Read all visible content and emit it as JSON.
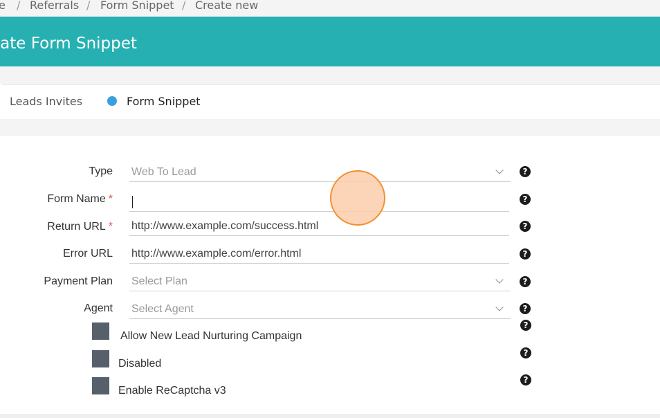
{
  "breadcrumb": {
    "items": [
      "e",
      "Referrals",
      "Form Snippet",
      "Create new"
    ],
    "separator": "/"
  },
  "header": {
    "title": "eate Form Snippet",
    "color": "#26b0b2"
  },
  "tabs": {
    "inactive_label": "Leads Invites",
    "active_label": "Form Snippet",
    "active_dot_color": "#3a9fe0"
  },
  "form": {
    "type": {
      "label": "Type",
      "value": "Web To Lead"
    },
    "form_name": {
      "label": "Form Name",
      "required_mark": "*",
      "value": ""
    },
    "return_url": {
      "label": "Return URL",
      "required_mark": "*",
      "value": "http://www.example.com/success.html"
    },
    "error_url": {
      "label": "Error URL",
      "value": "http://www.example.com/error.html"
    },
    "payment_plan": {
      "label": "Payment Plan",
      "placeholder": "Select Plan"
    },
    "agent": {
      "label": "Agent",
      "placeholder": "Select Agent"
    },
    "checkboxes": [
      {
        "label": "Allow New Lead Nurturing Campaign",
        "checked": false
      },
      {
        "label": "Disabled",
        "checked": false
      },
      {
        "label": "Enable ReCaptcha v3",
        "checked": false
      }
    ],
    "help_glyph": "?"
  }
}
